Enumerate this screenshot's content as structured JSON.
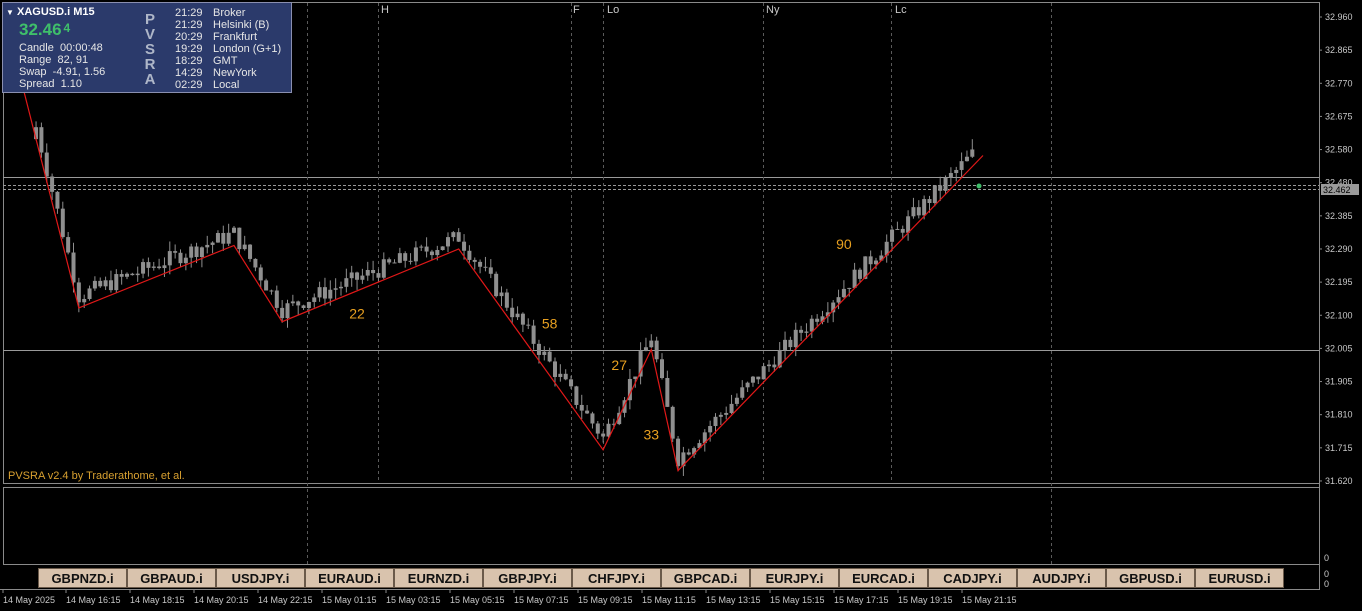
{
  "info_panel": {
    "symbol": "XAGUSD.i",
    "timeframe": "M15",
    "price_main": "32.46",
    "price_fraction": "4",
    "rows": [
      {
        "label": "Candle",
        "value": "00:00:48"
      },
      {
        "label": "Range",
        "value": "82, 91"
      },
      {
        "label": "Swap",
        "value": "-4.91, 1.56"
      },
      {
        "label": "Spread",
        "value": "1.10"
      }
    ],
    "pvsra_letters": [
      "P",
      "V",
      "S",
      "R",
      "A"
    ],
    "sessions": [
      {
        "time": "21:29",
        "name": "Broker"
      },
      {
        "time": "21:29",
        "name": "Helsinki (B)"
      },
      {
        "time": "20:29",
        "name": "Frankfurt"
      },
      {
        "time": "19:29",
        "name": "London (G+1)"
      },
      {
        "time": "18:29",
        "name": "GMT"
      },
      {
        "time": "14:29",
        "name": "NewYork"
      },
      {
        "time": "02:29",
        "name": "Local"
      }
    ]
  },
  "session_markers": [
    "H",
    "F",
    "Lo",
    "Ny",
    "Lc"
  ],
  "indicator_label": "PVSRA v2.4 by Traderathome, et al.",
  "current_price_label": "32.462",
  "price_axis_labels": [
    "32.960",
    "32.865",
    "32.770",
    "32.675",
    "32.580",
    "32.480",
    "32.385",
    "32.290",
    "32.195",
    "32.100",
    "32.005",
    "31.905",
    "31.810",
    "31.715",
    "31.620"
  ],
  "sub_axis_labels": [
    "0",
    "0"
  ],
  "tab_axis_labels": [
    "0",
    "0"
  ],
  "time_axis_labels": [
    "14 May 2025",
    "14 May 16:15",
    "14 May 18:15",
    "14 May 20:15",
    "14 May 22:15",
    "15 May 01:15",
    "15 May 03:15",
    "15 May 05:15",
    "15 May 07:15",
    "15 May 09:15",
    "15 May 11:15",
    "15 May 13:15",
    "15 May 15:15",
    "15 May 17:15",
    "15 May 19:15",
    "15 May 21:15"
  ],
  "symbol_tabs": [
    "GBPNZD.i",
    "GBPAUD.i",
    "USDJPY.i",
    "EURAUD.i",
    "EURNZD.i",
    "GBPJPY.i",
    "CHFJPY.i",
    "GBPCAD.i",
    "EURJPY.i",
    "EURCAD.i",
    "CADJPY.i",
    "AUDJPY.i",
    "GBPUSD.i",
    "EURUSD.i"
  ],
  "colors": {
    "background": "#000000",
    "candle": "#8f8f8f",
    "zigzag": "#e01818",
    "wave_label": "#e8a020",
    "grid": "#3a3a3a",
    "axis_text": "#c8c8c8",
    "panel_bg": "#2b3a6b",
    "tab_bg": "#d9c3ad",
    "price_green": "#3fbf6a"
  },
  "chart_data": {
    "type": "candlestick",
    "y_range": [
      31.62,
      32.96
    ],
    "zigzag_points": [
      {
        "bar": 0,
        "price": 32.79
      },
      {
        "bar": 11,
        "price": 32.12
      },
      {
        "bar": 40,
        "price": 32.3
      },
      {
        "bar": 49,
        "price": 32.08
      },
      {
        "bar": 82,
        "price": 32.29
      },
      {
        "bar": 109,
        "price": 31.71
      },
      {
        "bar": 118,
        "price": 32.0
      },
      {
        "bar": 123,
        "price": 31.65
      },
      {
        "bar": 180,
        "price": 32.56
      }
    ],
    "wave_labels": [
      {
        "text": "22",
        "bar": 63,
        "price": 32.09
      },
      {
        "text": "58",
        "bar": 99,
        "price": 32.06
      },
      {
        "text": "27",
        "bar": 112,
        "price": 31.94
      },
      {
        "text": "33",
        "bar": 118,
        "price": 31.74
      },
      {
        "text": "90",
        "bar": 154,
        "price": 32.29
      }
    ]
  }
}
